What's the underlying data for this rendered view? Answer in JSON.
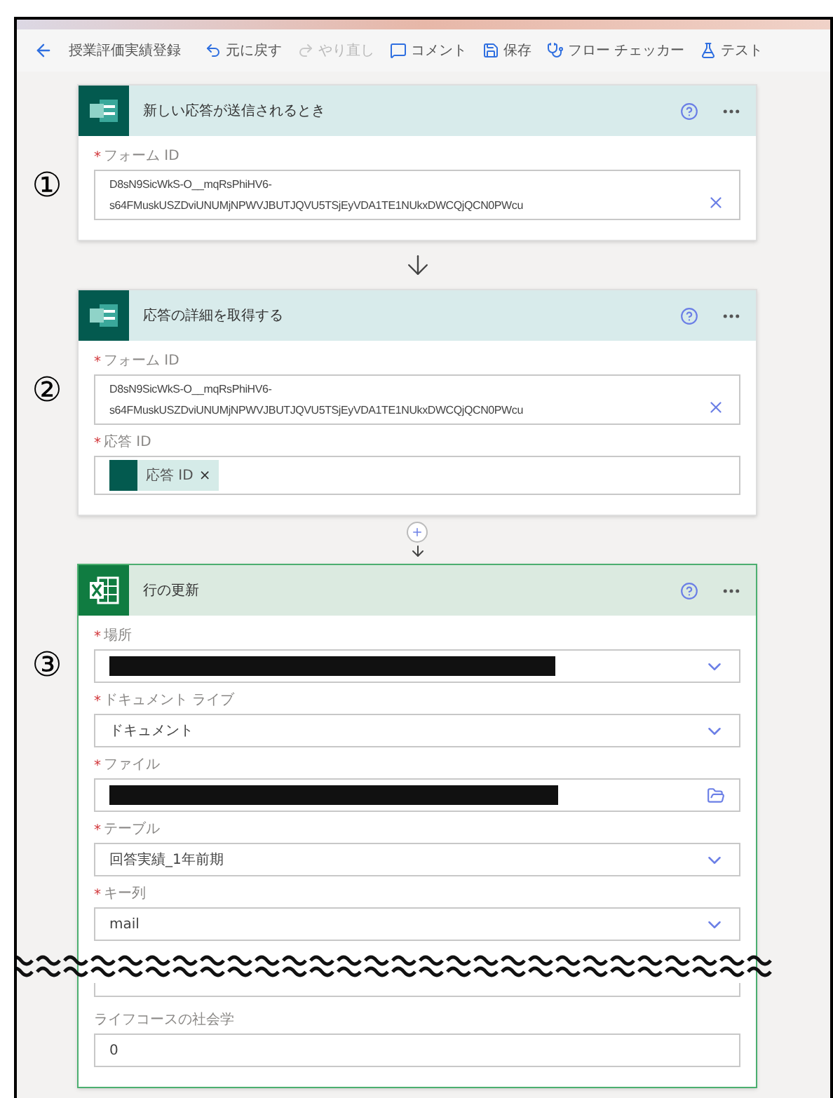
{
  "toolbar": {
    "title": "授業評価実績登録",
    "actions": [
      {
        "kind": "undo",
        "label": "元に戻す",
        "disabled": false
      },
      {
        "kind": "redo",
        "label": "やり直し",
        "disabled": true
      },
      {
        "kind": "comment",
        "label": "コメント",
        "disabled": false
      },
      {
        "kind": "save",
        "label": "保存",
        "disabled": false
      },
      {
        "kind": "checker",
        "label": "フロー チェッカー",
        "disabled": false
      },
      {
        "kind": "test",
        "label": "テスト",
        "disabled": false
      }
    ]
  },
  "steps": [
    {
      "marker": "①",
      "kind": "forms",
      "title": "新しい応答が送信されるとき",
      "connector": {
        "kind": "arrow"
      },
      "fields": [
        {
          "kind": "text",
          "label": "フォーム ID",
          "required_mark": "*",
          "value_lines": [
            "D8sN9SicWkS-O__mqRsPhiHV6-",
            "s64FMuskUSZDviUNUMjNPWVJBUTJQVU5TSjEyVDA1TE1NUkxDWCQjQCN0PWcu"
          ]
        }
      ]
    },
    {
      "marker": "②",
      "kind": "forms",
      "title": "応答の詳細を取得する",
      "connector": {
        "kind": "plus"
      },
      "fields": [
        {
          "kind": "text",
          "label": "フォーム ID",
          "required_mark": "*",
          "value_lines": [
            "D8sN9SicWkS-O__mqRsPhiHV6-",
            "s64FMuskUSZDviUNUMjNPWVJBUTJQVU5TSjEyVDA1TE1NUkxDWCQjQCN0PWcu"
          ]
        },
        {
          "kind": "token",
          "label": "応答 ID",
          "required_mark": "*",
          "token": "応答 ID",
          "remove": "×"
        }
      ]
    },
    {
      "marker": "③",
      "kind": "excel",
      "title": "行の更新",
      "fields": [
        {
          "kind": "dropdown",
          "label": "場所",
          "required_mark": "*",
          "redacted": true
        },
        {
          "kind": "dropdown",
          "label": "ドキュメント ライブ",
          "required_mark": "*",
          "value": "ドキュメント"
        },
        {
          "kind": "file",
          "label": "ファイル",
          "required_mark": "*",
          "redacted": true
        },
        {
          "kind": "dropdown",
          "label": "テーブル",
          "required_mark": "*",
          "value": "回答実績_1年前期"
        },
        {
          "kind": "dropdown",
          "label": "キー列",
          "required_mark": "*",
          "value": "mail"
        },
        {
          "kind": "break"
        },
        {
          "kind": "input",
          "label": "ライフコースの社会学",
          "value": "0"
        }
      ]
    }
  ]
}
